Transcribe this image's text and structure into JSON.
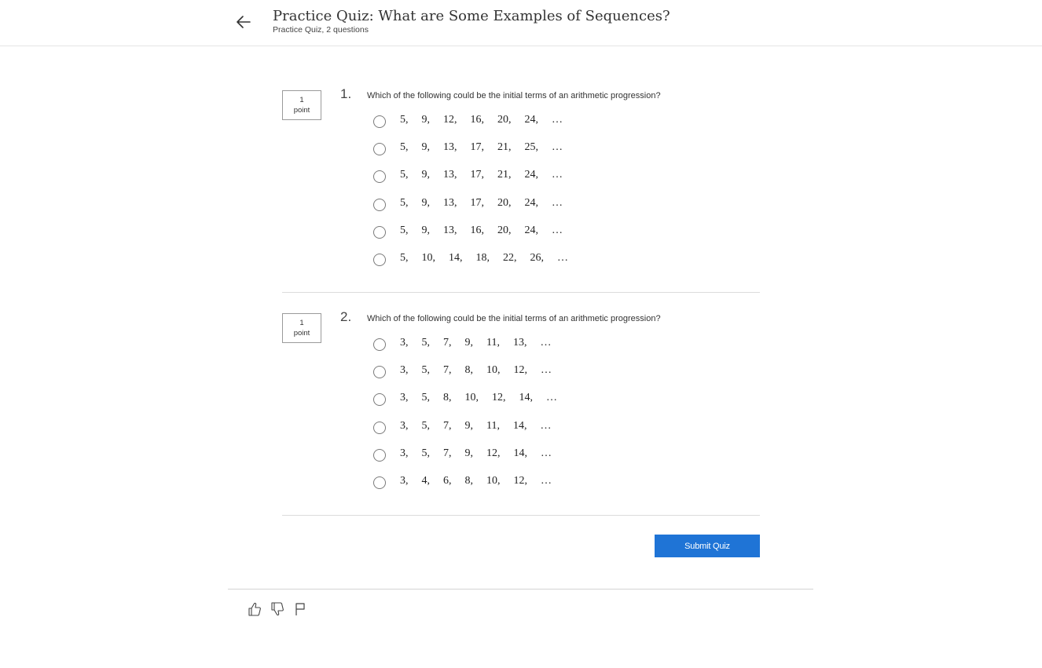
{
  "header": {
    "title": "Practice Quiz: What are Some Examples of Sequences?",
    "subtitle": "Practice Quiz, 2 questions",
    "back_icon": "arrow-left-icon"
  },
  "questions": [
    {
      "number": "1.",
      "points_value": "1",
      "points_unit": "point",
      "text": "Which of the following could be the initial terms of an arithmetic progression?",
      "options": [
        "5,  9,  12,  16,  20,  24,  …",
        "5,  9,  13,  17,  21,  25,  …",
        "5,  9,  13,  17,  21,  24,  …",
        "5,  9,  13,  17,  20,  24,  …",
        "5,  9,  13,  16,  20,  24,  …",
        "5,  10,  14,  18,  22,  26,  …"
      ]
    },
    {
      "number": "2.",
      "points_value": "1",
      "points_unit": "point",
      "text": "Which of the following could be the initial terms of an arithmetic progression?",
      "options": [
        "3,  5,  7,  9,  11,  13,  …",
        "3,  5,  7,  8,  10,  12,  …",
        "3,  5,  8,  10,  12,  14,  …",
        "3,  5,  7,  9,  11,  14,  …",
        "3,  5,  7,  9,  12,  14,  …",
        "3,  4,  6,  8,  10,  12,  …"
      ]
    }
  ],
  "submit_label": "Submit Quiz",
  "footer": {
    "icons": [
      "thumbs-up-icon",
      "thumbs-down-icon",
      "flag-icon"
    ]
  },
  "colors": {
    "accent": "#1f74d6",
    "divider": "#dcdcdc"
  }
}
